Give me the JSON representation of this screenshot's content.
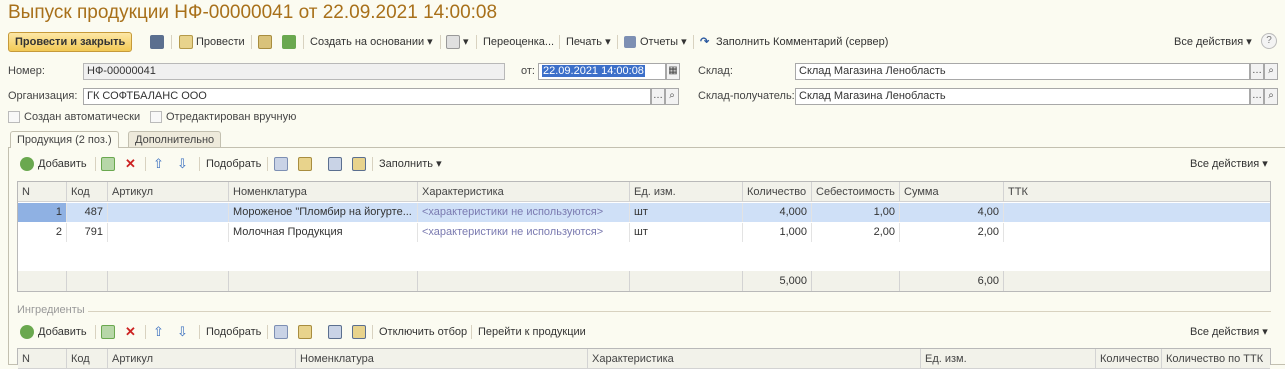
{
  "title": "Выпуск продукции НФ-00000041 от 22.09.2021 14:00:08",
  "toolbar": {
    "post_close": "Провести и закрыть",
    "post": "Провести",
    "create_based": "Создать на основании",
    "revaluation": "Переоценка...",
    "print": "Печать",
    "reports": "Отчеты",
    "fill_comment": "Заполнить Комментарий (сервер)",
    "all_actions": "Все действия",
    "help": "?"
  },
  "header": {
    "number_label": "Номер:",
    "number_value": "НФ-00000041",
    "date_label": "от:",
    "date_value": "22.09.2021 14:00:08",
    "warehouse_label": "Склад:",
    "warehouse_value": "Склад Магазина Ленобласть",
    "org_label": "Организация:",
    "org_value": "ГК СОФТБАЛАНС ООО",
    "recipient_label": "Склад-получатель:",
    "recipient_value": "Склад Магазина Ленобласть",
    "auto_created": "Создан автоматически",
    "manual_edited": "Отредактирован вручную"
  },
  "tabs": [
    {
      "label": "Продукция (2 поз.)"
    },
    {
      "label": "Дополнительно"
    }
  ],
  "products_toolbar": {
    "add": "Добавить",
    "pick": "Подобрать",
    "fill": "Заполнить",
    "all_actions": "Все действия"
  },
  "products_table": {
    "columns": [
      "N",
      "Код",
      "Артикул",
      "Номенклатура",
      "Характеристика",
      "Ед. изм.",
      "Количество",
      "Себестоимость",
      "Сумма",
      "ТТК"
    ],
    "rows": [
      {
        "n": "1",
        "code": "487",
        "article": "",
        "name": "Мороженое \"Пломбир на йогурте...",
        "char": "<характеристики не используются>",
        "unit": "шт",
        "qty": "4,000",
        "cost": "1,00",
        "sum": "4,00",
        "ttk": ""
      },
      {
        "n": "2",
        "code": "791",
        "article": "",
        "name": "Молочная Продукция",
        "char": "<характеристики не используются>",
        "unit": "шт",
        "qty": "1,000",
        "cost": "2,00",
        "sum": "2,00",
        "ttk": ""
      }
    ],
    "totals": {
      "qty": "5,000",
      "sum": "6,00"
    }
  },
  "ingredients": {
    "label": "Ингредиенты",
    "add": "Добавить",
    "pick": "Подобрать",
    "disable_filter": "Отключить отбор",
    "go_to_products": "Перейти к продукции",
    "all_actions": "Все действия",
    "columns": [
      "N",
      "Код",
      "Артикул",
      "Номенклатура",
      "Характеристика",
      "Ед. изм.",
      "Количество",
      "Количество по ТТК"
    ]
  },
  "colors": {
    "title": "#a8701a",
    "accent_button": "#f2c955",
    "selection": "#cfe0f7"
  }
}
